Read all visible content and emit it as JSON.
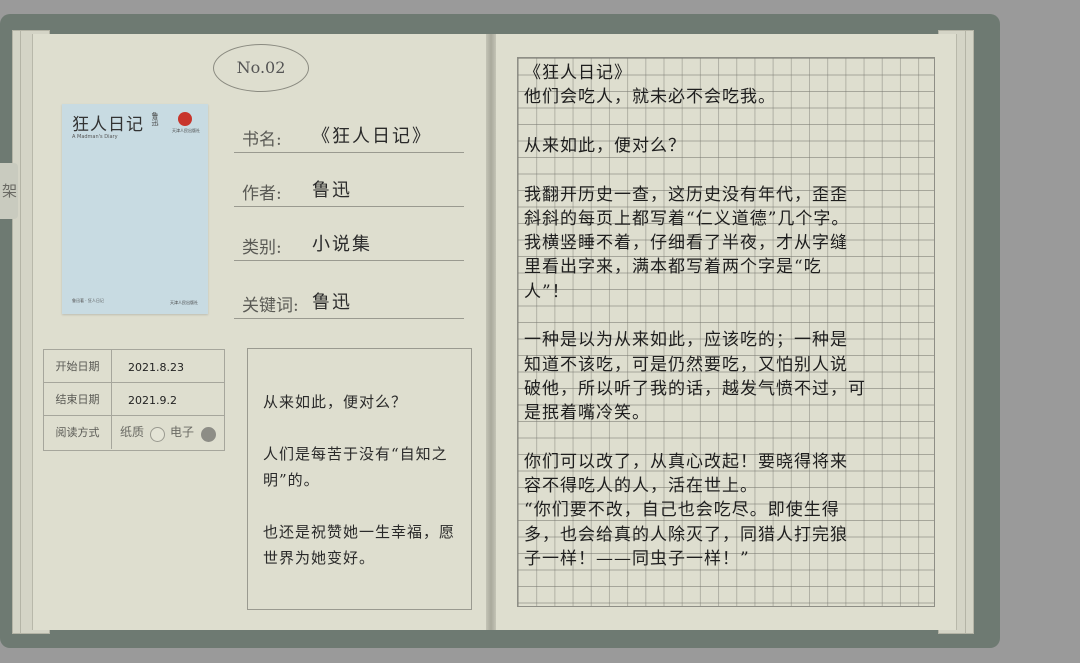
{
  "side_tab": {
    "label": "架"
  },
  "record": {
    "number": "No.02",
    "cover": {
      "title": "狂人日记",
      "subtitle": "A Madman's Diary",
      "author_mark": "鲁迅",
      "badge_text": "天津人民出版社",
      "bottom_left": "鲁迅著 · 狂人日记",
      "bottom_right": "天津人民出版社"
    },
    "fields": [
      {
        "label": "书名:",
        "value": "《狂人日记》"
      },
      {
        "label": "作者:",
        "value": "鲁迅"
      },
      {
        "label": "类别:",
        "value": "小说集"
      },
      {
        "label": "关键词:",
        "value": "鲁迅"
      }
    ],
    "start_label": "开始日期",
    "start_date": "2021.8.23",
    "end_label": "结束日期",
    "end_date": "2021.9.2",
    "read_mode_label": "阅读方式",
    "read_mode_paper": "纸质",
    "read_mode_ebook": "电子",
    "read_mode_selected": "电子",
    "quote": [
      "从来如此，便对么？",
      "人们是每苦于没有“自知之明”的。",
      "也还是祝赞她一生幸福，愿世界为她变好。"
    ]
  },
  "diary": {
    "lines": [
      "《狂人日记》",
      "他们会吃人，就未必不会吃我。",
      "",
      "从来如此，便对么？",
      "",
      "我翻开历史一查，这历史没有年代，歪歪",
      "斜斜的每页上都写着“仁义道德”几个字。",
      "我横竖睡不着，仔细看了半夜，才从字缝",
      "里看出字来，满本都写着两个字是“吃",
      "人”！",
      "",
      "一种是以为从来如此，应该吃的；一种是",
      "知道不该吃，可是仍然要吃，又怕别人说",
      "破他，所以听了我的话，越发气愤不过，可",
      "是抿着嘴冷笑。",
      "",
      "你们可以改了，从真心改起！要晓得将来",
      "容不得吃人的人，活在世上。",
      "“你们要不改，自己也会吃尽。即使生得",
      "多，也会给真的人除灭了，同猎人打完狼",
      "子一样！——同虫子一样！”"
    ]
  },
  "colors": {
    "paper": "#dedecf",
    "frame": "#6e7a72",
    "ink": "#1e1e1e"
  }
}
